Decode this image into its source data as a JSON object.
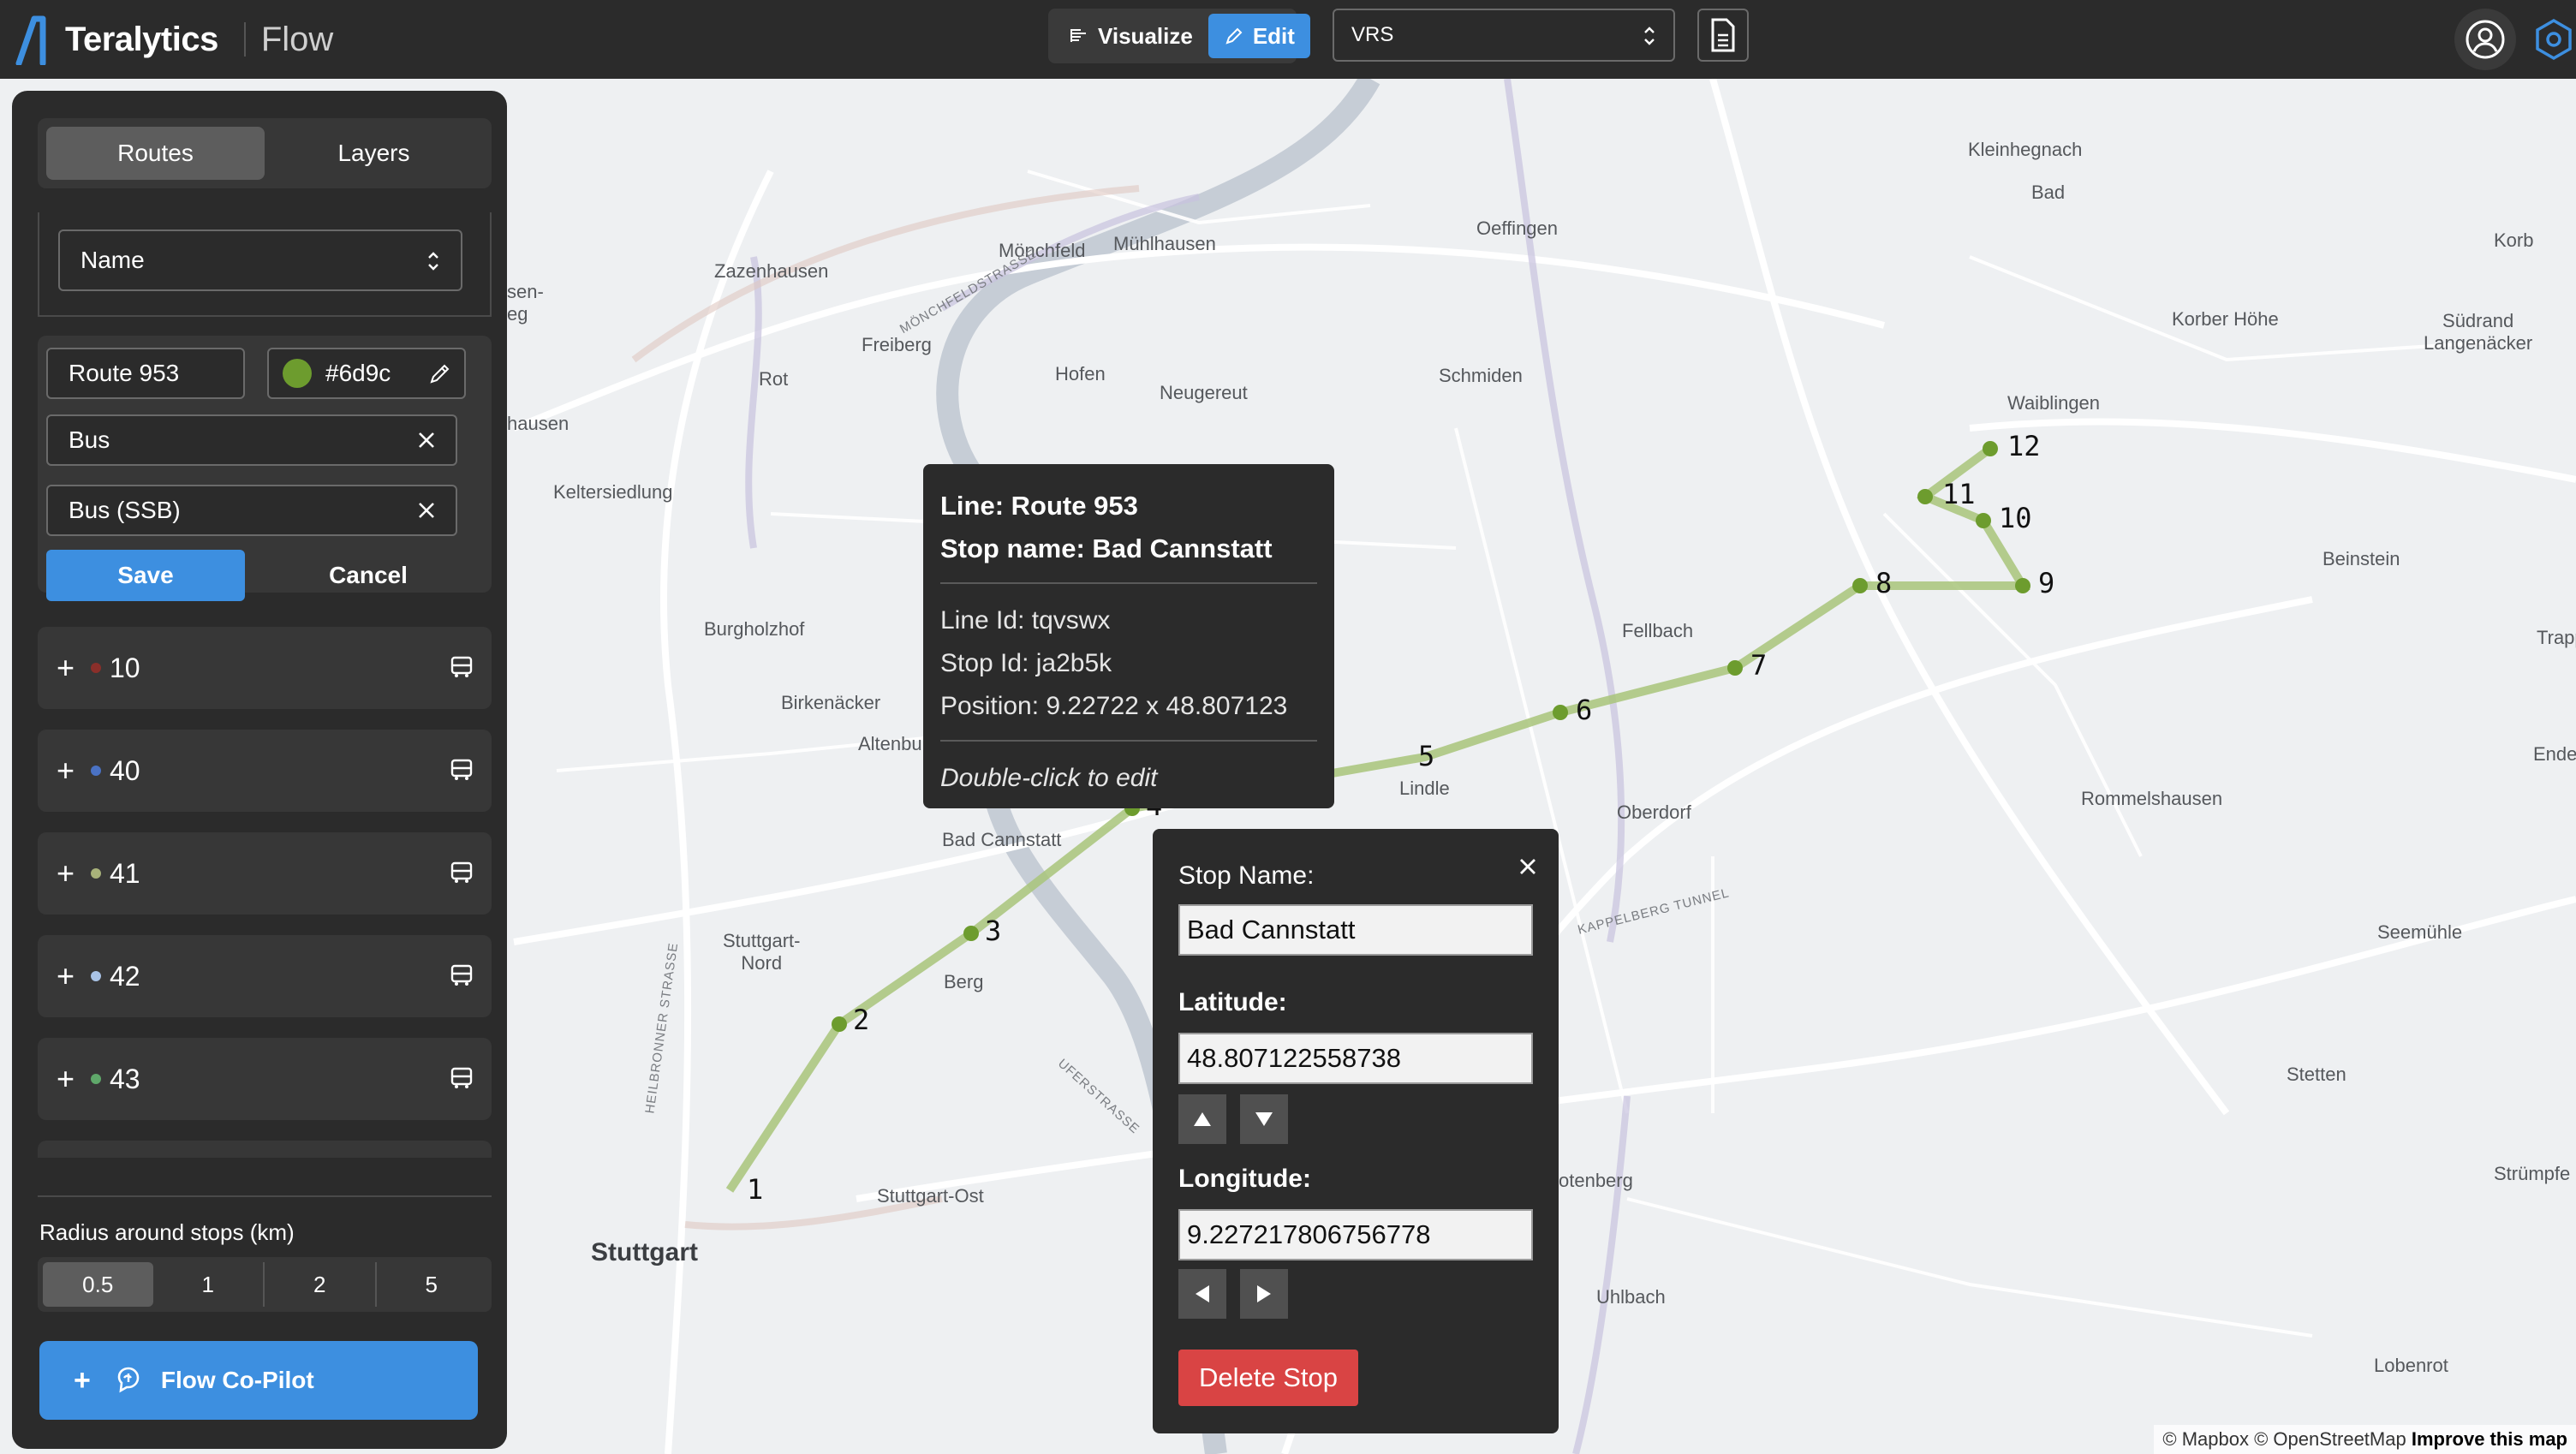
{
  "header": {
    "brand": "Teralytics",
    "product": "Flow",
    "modes": {
      "visualize": "Visualize",
      "edit": "Edit"
    },
    "dataset": "VRS"
  },
  "sidebar": {
    "tabs": {
      "routes": "Routes",
      "layers": "Layers"
    },
    "sort_by": "Name",
    "editor": {
      "route_name": "Route 953",
      "color_hex": "#6d9c",
      "color": "#6d9c2e",
      "mode": "Bus",
      "operator": "Bus (SSB)",
      "save": "Save",
      "cancel": "Cancel"
    },
    "routes": [
      {
        "name": "10",
        "color": "#8a2f2a"
      },
      {
        "name": "40",
        "color": "#4a72c4"
      },
      {
        "name": "41",
        "color": "#a8b27a"
      },
      {
        "name": "42",
        "color": "#a9c3e6"
      },
      {
        "name": "43",
        "color": "#5fa86a"
      }
    ],
    "radius_label": "Radius around stops (km)",
    "radius_options": [
      "0.5",
      "1",
      "2",
      "5"
    ],
    "copilot": "Flow Co-Pilot"
  },
  "map": {
    "labels": {
      "kleinhegnach": "Kleinhegnach",
      "bad": "Bad",
      "korb": "Korb",
      "oeffingen": "Oeffingen",
      "zazenhausen": "Zazenhausen",
      "monchfeld": "Mönchfeld",
      "muhlhausen": "Mühlhausen",
      "freiberg": "Freiberg",
      "korber_hohe": "Korber Höhe",
      "sudrand": "Südrand\nLangenäcker",
      "sen": "sen-\neg",
      "rot": "Rot",
      "hofen": "Hofen",
      "neugereut": "Neugereut",
      "schmiden": "Schmiden",
      "waiblingen": "Waiblingen",
      "hausen": "hausen",
      "keltersiedlung": "Keltersiedlung",
      "beinstein": "Beinstein",
      "burgholzhof": "Burgholzhof",
      "fellbach": "Fellbach",
      "trappe": "Trappe",
      "birkenacker": "Birkenäcker",
      "altenbu": "Altenbu",
      "enders": "Enders",
      "lindle": "Lindle",
      "rommelshausen": "Rommelshausen",
      "oberdorf": "Oberdorf",
      "bad_cannstatt": "Bad Cannstatt",
      "stuttgart_nord": "Stuttgart-\nNord",
      "seemuhle": "Seemühle",
      "berg": "Berg",
      "stetten": "Stetten",
      "strumpfe": "Strümpfe",
      "stuttgart_ost": "Stuttgart-Ost",
      "otenberg": "otenberg",
      "stuttgart": "Stuttgart",
      "uhlbach": "Uhlbach",
      "lobenrot": "Lobenrot",
      "monchfeldstrasse": "MÖNCHFELDSTRASSE",
      "heilbronner": "HEILBRONNER STRASSE",
      "uferstrasse": "UFERSTRASSE",
      "kappelberg": "KAPPELBERG TUNNEL"
    },
    "stops": [
      "1",
      "2",
      "3",
      "4",
      "5",
      "6",
      "7",
      "8",
      "9",
      "10",
      "11",
      "12"
    ],
    "attribution": "© Mapbox © OpenStreetMap",
    "improve": "Improve this map"
  },
  "tooltip": {
    "line": "Line: Route 953",
    "stop_name": "Stop name: Bad Cannstatt",
    "line_id": "Line Id: tqvswx",
    "stop_id": "Stop Id: ja2b5k",
    "position": "Position: 9.22722 x 48.807123",
    "hint": "Double-click to edit"
  },
  "stop_editor": {
    "name_label": "Stop Name:",
    "name_value": "Bad Cannstatt",
    "lat_label": "Latitude:",
    "lat_value": "48.807122558738",
    "lon_label": "Longitude:",
    "lon_value": "9.227217806756778",
    "delete": "Delete Stop"
  }
}
